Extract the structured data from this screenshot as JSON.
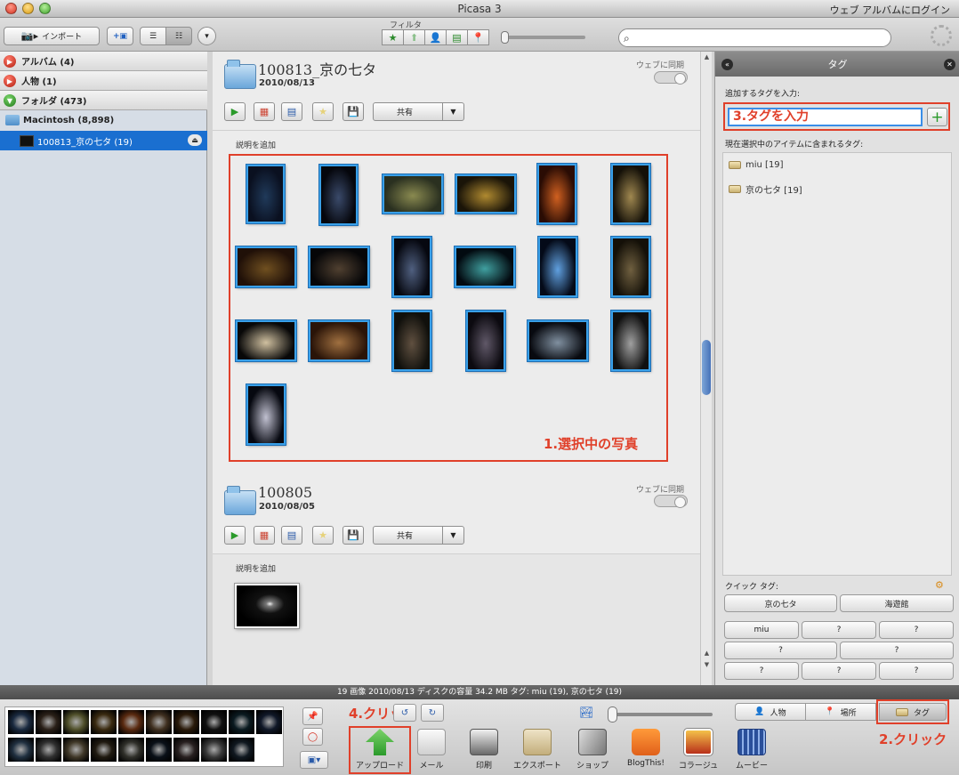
{
  "window": {
    "title": "Picasa 3",
    "web_login": "ウェブ アルバムにログイン"
  },
  "toolbar": {
    "import_label": "インポート",
    "filter_label": "フィルタ"
  },
  "left_panel": {
    "albums": "アルバム (4)",
    "people": "人物 (1)",
    "folders": "フォルダ (473)",
    "volume": "Macintosh (8,898)",
    "selected_folder": "100813_京の七タ (19)"
  },
  "sections": [
    {
      "title": "100813_京の七タ",
      "date": "2010/08/13",
      "sync_label": "ウェブに同期",
      "share_label": "共有",
      "desc_label": "説明を追加"
    },
    {
      "title": "100805",
      "date": "2010/08/05",
      "sync_label": "ウェブに同期",
      "share_label": "共有",
      "desc_label": "説明を追加"
    }
  ],
  "annotations": {
    "selected": "1.選択中の写真",
    "click_tag": "2.クリック",
    "enter_tag": "3.タグを入力",
    "click_upload": "4.クリック"
  },
  "tags_panel": {
    "title": "タグ",
    "add_label": "追加するタグを入力:",
    "current_label": "現在選択中のアイテムに含まれるタグ:",
    "current_tags": [
      "miu [19]",
      "京の七タ [19]"
    ],
    "quick_label": "クイック タグ:",
    "quick_tags": [
      "京の七タ",
      "海遊館",
      "miu",
      "?",
      "?",
      "?",
      "?",
      "?",
      "?",
      "?"
    ]
  },
  "status": "19 画像     2010/08/13     ディスクの容量 34.2 MB     タグ: miu (19), 京の七タ (19)",
  "bottom": {
    "people_label": "人物",
    "places_label": "場所",
    "tags_label": "タグ",
    "actions": [
      "アップロード",
      "メール",
      "印刷",
      "エクスポート",
      "ショップ",
      "BlogThis!",
      "コラージュ",
      "ムービー"
    ]
  }
}
